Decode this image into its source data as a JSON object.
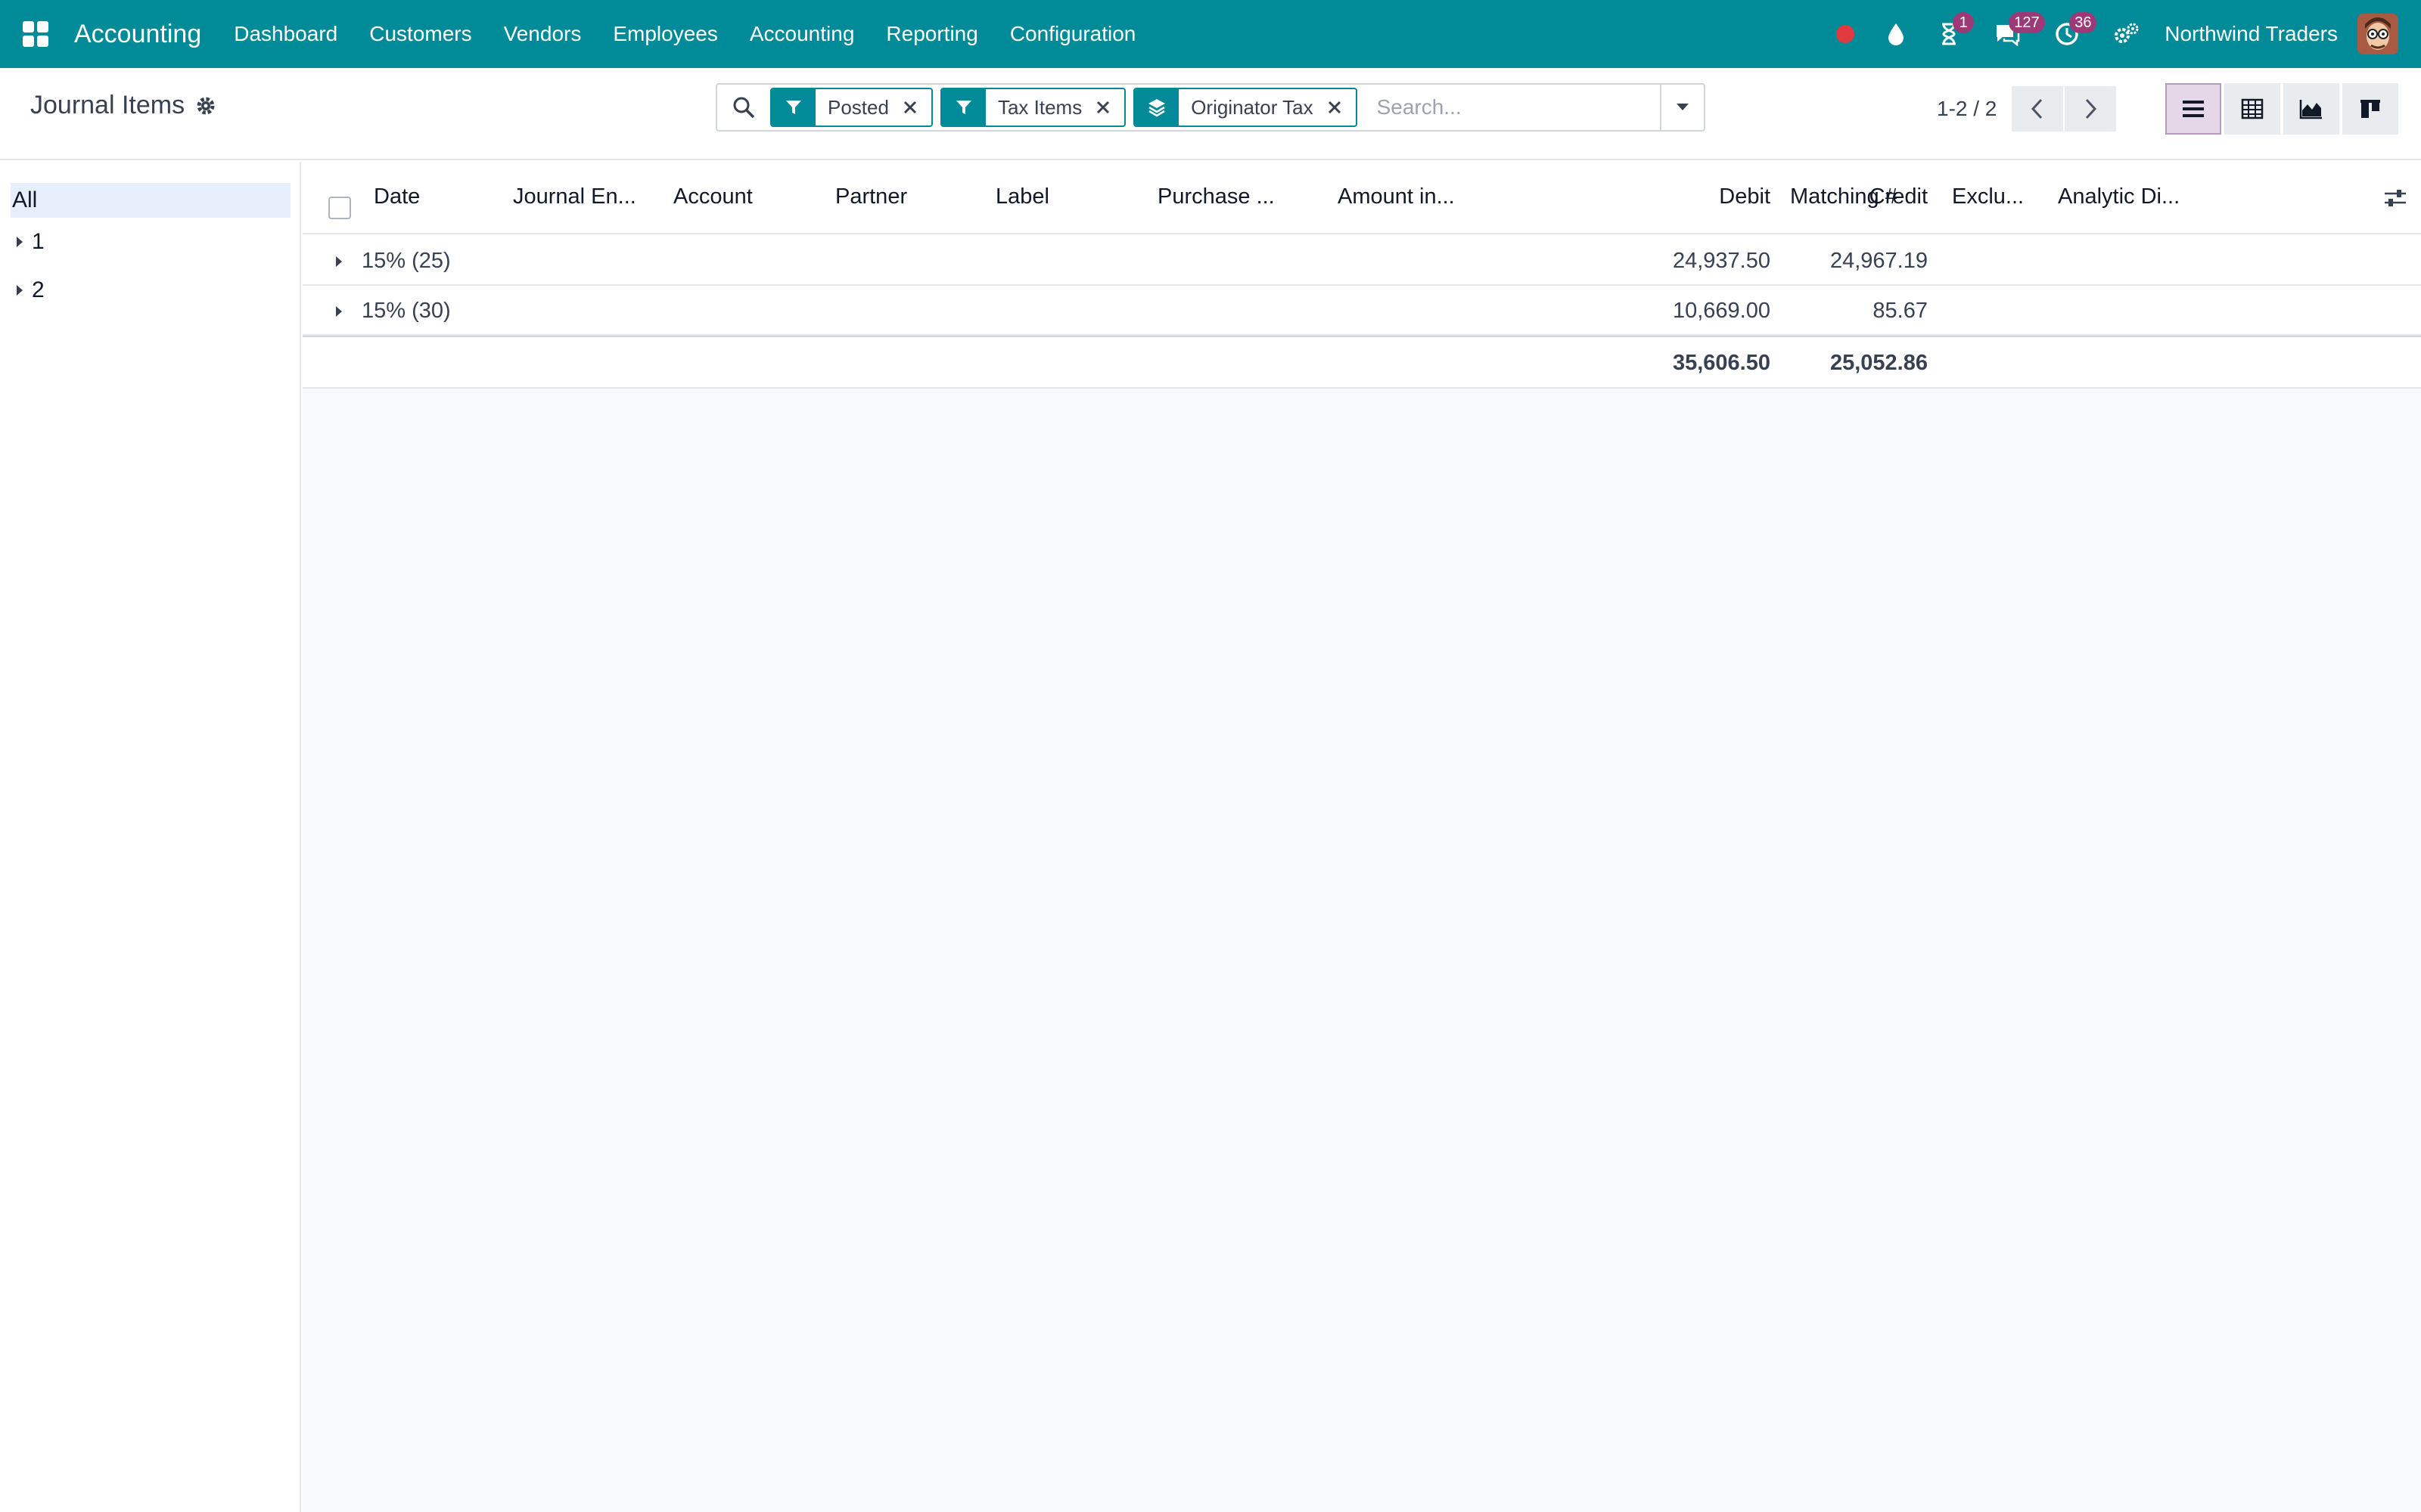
{
  "navbar": {
    "app_name": "Accounting",
    "menu": [
      "Dashboard",
      "Customers",
      "Vendors",
      "Employees",
      "Accounting",
      "Reporting",
      "Configuration"
    ],
    "badges": {
      "activities": "1",
      "messages": "127",
      "timesheets": "36"
    },
    "company": "Northwind Traders",
    "colors": {
      "bar": "#018a98",
      "badge": "#9b3a76",
      "record": "#e0393e"
    }
  },
  "control": {
    "title": "Journal Items",
    "facets": [
      {
        "icon": "filter-icon",
        "label": "Posted"
      },
      {
        "icon": "filter-icon",
        "label": "Tax Items"
      },
      {
        "icon": "layers-icon",
        "label": "Originator Tax"
      }
    ],
    "search_placeholder": "Search...",
    "pager": "1-2 / 2",
    "active_view": "list"
  },
  "sidebar": {
    "all_label": "All",
    "items": [
      "1",
      "2"
    ]
  },
  "list": {
    "columns": [
      "Date",
      "Journal En...",
      "Account",
      "Partner",
      "Label",
      "Purchase ...",
      "Amount in...",
      "Debit",
      "Credit",
      "Matching #",
      "Exclu...",
      "Analytic Di..."
    ],
    "groups": [
      {
        "name": "15% (25)",
        "debit": "24,937.50",
        "credit": "24,967.19"
      },
      {
        "name": "15% (30)",
        "debit": "10,669.00",
        "credit": "85.67"
      }
    ],
    "totals": {
      "debit": "35,606.50",
      "credit": "25,052.86"
    }
  }
}
